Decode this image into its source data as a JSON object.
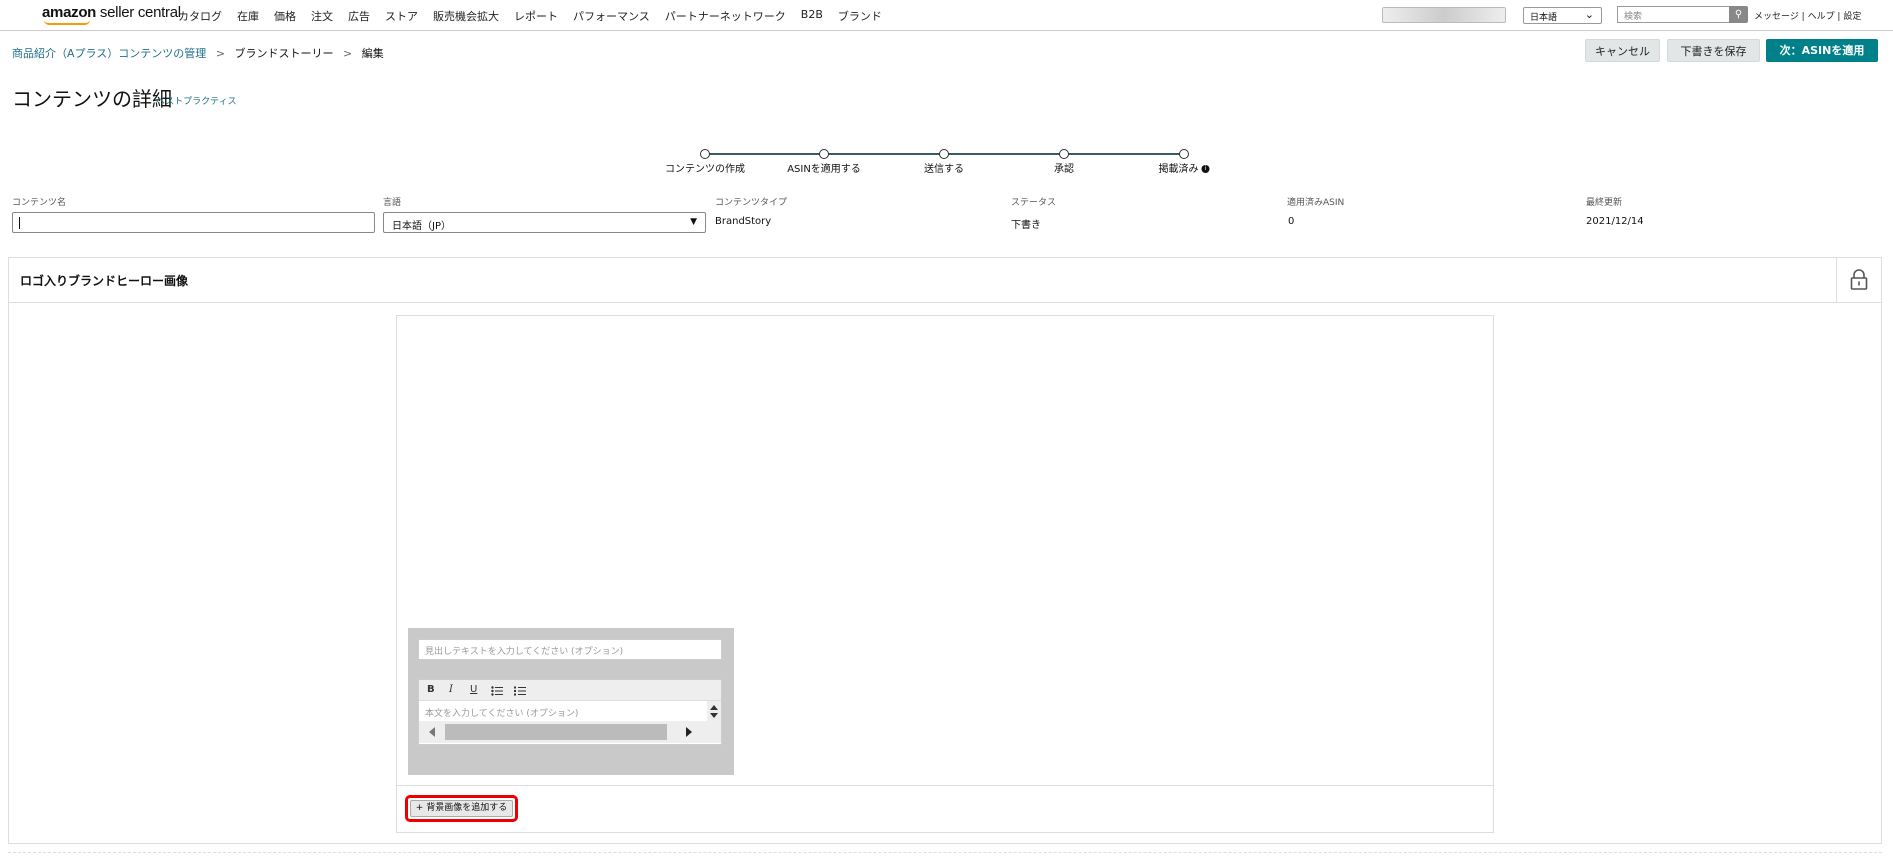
{
  "header": {
    "logo_amazon": "amazon",
    "logo_rest": " seller central",
    "nav": [
      "カタログ",
      "在庫",
      "価格",
      "注文",
      "広告",
      "ストア",
      "販売機会拡大",
      "レポート",
      "パフォーマンス",
      "パートナーネットワーク",
      "B2B",
      "ブランド"
    ],
    "language": "日本語",
    "search_placeholder": "検索",
    "links": "メッセージ | ヘルプ | 設定"
  },
  "breadcrumb": {
    "item1": "商品紹介（Aプラス）コンテンツの管理",
    "item2": "ブランドストーリー",
    "item3": "編集",
    "separator": ">"
  },
  "actions": {
    "cancel": "キャンセル",
    "save_draft": "下書きを保存",
    "next": "次：ASINを適用"
  },
  "page": {
    "title": "コンテンツの詳細",
    "best_practices": "ベストプラクティス"
  },
  "steps": [
    "コンテンツの作成",
    "ASINを適用する",
    "送信する",
    "承認",
    "掲載済み"
  ],
  "details": {
    "name_label": "コンテンツ名",
    "name_value": "",
    "language_label": "言語",
    "language_value": "日本語（JP）",
    "type_label": "コンテンツタイプ",
    "type_value": "BrandStory",
    "status_label": "ステータス",
    "status_value": "下書き",
    "asin_label": "適用済みASIN",
    "asin_value": "0",
    "updated_label": "最終更新",
    "updated_value": "2021/12/14"
  },
  "module": {
    "title": "ロゴ入りブランドヒーロー画像",
    "headline_placeholder": "見出しテキストを入力してください (オプション)",
    "body_placeholder": "本文を入力してください (オプション)",
    "toolbar": [
      "B",
      "I",
      "U"
    ],
    "add_background": "+ 背景画像を追加する"
  },
  "colors": {
    "accent": "#00818a",
    "link": "#1f6f8b",
    "highlight": "#e00000"
  }
}
